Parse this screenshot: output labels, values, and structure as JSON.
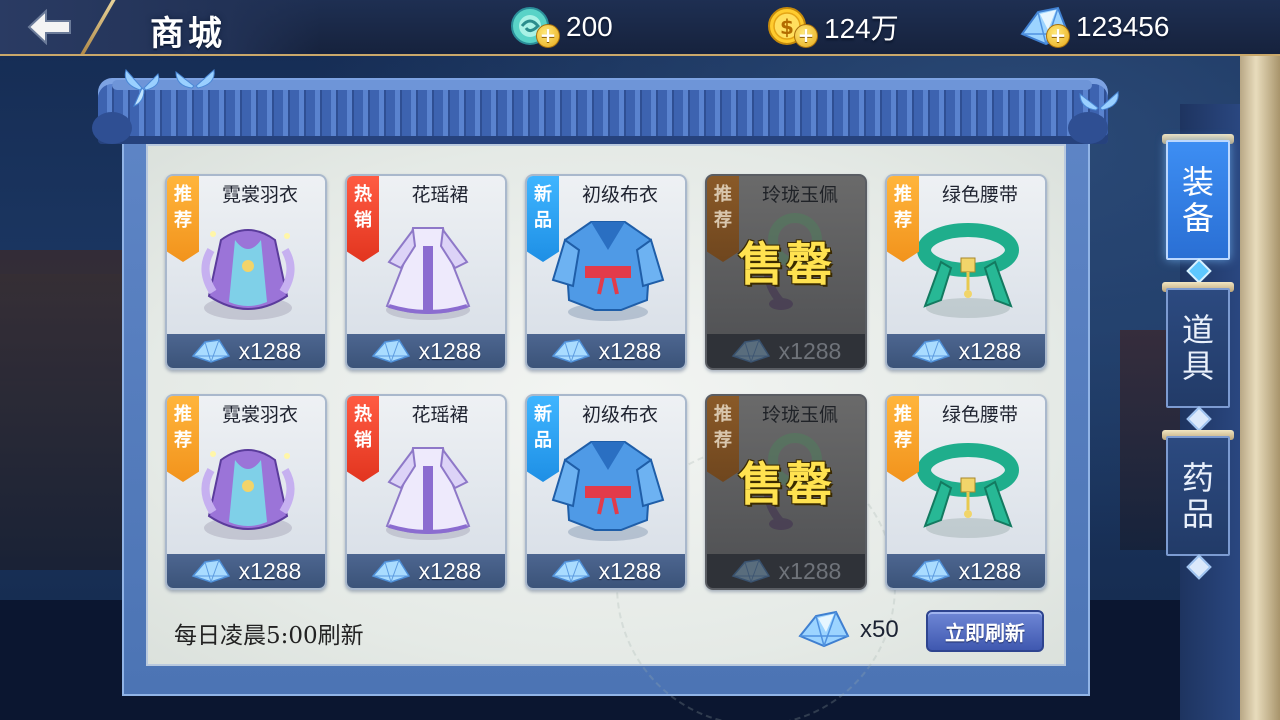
{
  "header": {
    "title": "商城",
    "currencies": [
      {
        "icon": "jade-orb-icon",
        "value": "200"
      },
      {
        "icon": "gold-coin-icon",
        "value": "124万"
      },
      {
        "icon": "diamond-icon",
        "value": "123456"
      }
    ]
  },
  "shop": {
    "items": [
      {
        "name": "霓裳羽衣",
        "tag": [
          "推",
          "荐"
        ],
        "tag_color": "orange",
        "price": "x1288",
        "sold_out": false,
        "art": "purple-robe"
      },
      {
        "name": "花瑶裙",
        "tag": [
          "热",
          "销"
        ],
        "tag_color": "red",
        "price": "x1288",
        "sold_out": false,
        "art": "white-dress"
      },
      {
        "name": "初级布衣",
        "tag": [
          "新",
          "品"
        ],
        "tag_color": "blue",
        "price": "x1288",
        "sold_out": false,
        "art": "blue-robe"
      },
      {
        "name": "玲珑玉佩",
        "tag": [
          "推",
          "荐"
        ],
        "tag_color": "brown",
        "price": "x1288",
        "sold_out": true,
        "art": "jade-pendant"
      },
      {
        "name": "绿色腰带",
        "tag": [
          "推",
          "荐"
        ],
        "tag_color": "orange",
        "price": "x1288",
        "sold_out": false,
        "art": "green-belt"
      },
      {
        "name": "霓裳羽衣",
        "tag": [
          "推",
          "荐"
        ],
        "tag_color": "orange",
        "price": "x1288",
        "sold_out": false,
        "art": "purple-robe"
      },
      {
        "name": "花瑶裙",
        "tag": [
          "热",
          "销"
        ],
        "tag_color": "red",
        "price": "x1288",
        "sold_out": false,
        "art": "white-dress"
      },
      {
        "name": "初级布衣",
        "tag": [
          "新",
          "品"
        ],
        "tag_color": "blue",
        "price": "x1288",
        "sold_out": false,
        "art": "blue-robe"
      },
      {
        "name": "玲珑玉佩",
        "tag": [
          "推",
          "荐"
        ],
        "tag_color": "brown",
        "price": "x1288",
        "sold_out": true,
        "art": "jade-pendant"
      },
      {
        "name": "绿色腰带",
        "tag": [
          "推",
          "荐"
        ],
        "tag_color": "orange",
        "price": "x1288",
        "sold_out": false,
        "art": "green-belt"
      }
    ],
    "sold_out_label": "售罄",
    "refresh_info": "每日凌晨5:00刷新",
    "refresh_cost": "x50",
    "refresh_button": "立即刷新"
  },
  "side_tabs": [
    {
      "label": [
        "装",
        "备"
      ],
      "active": true
    },
    {
      "label": [
        "道",
        "具"
      ],
      "active": false
    },
    {
      "label": [
        "药",
        "品"
      ],
      "active": false
    }
  ],
  "colors": {
    "accent_blue": "#3d8ef3",
    "tag_orange": "#f2931c",
    "tag_red": "#e2351f",
    "tag_blue": "#1e8fe5",
    "sold_out_yellow": "#ffe250"
  }
}
